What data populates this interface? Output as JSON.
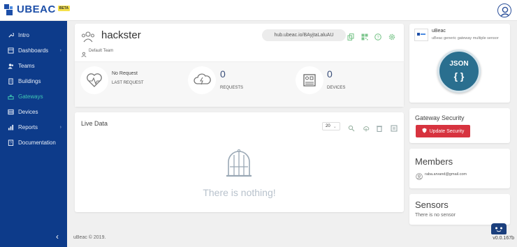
{
  "brand": {
    "name": "UBEAC",
    "badge": "BETA"
  },
  "sidebar": {
    "items": [
      {
        "label": "Intro",
        "icon": "wrench-icon",
        "chevron": ""
      },
      {
        "label": "Dashboards",
        "icon": "dashboard-icon",
        "chevron": "›"
      },
      {
        "label": "Teams",
        "icon": "teams-icon",
        "chevron": ""
      },
      {
        "label": "Buildings",
        "icon": "building-icon",
        "chevron": ""
      },
      {
        "label": "Gateways",
        "icon": "gateway-icon",
        "chevron": ""
      },
      {
        "label": "Devices",
        "icon": "devices-icon",
        "chevron": ""
      },
      {
        "label": "Reports",
        "icon": "reports-icon",
        "chevron": "›"
      },
      {
        "label": "Documentation",
        "icon": "documentation-icon",
        "chevron": ""
      }
    ],
    "active": "Gateways",
    "collapse_label": "‹"
  },
  "gateway": {
    "name": "hackster",
    "team": "Default Team",
    "url": "hub.ubeac.io/BAyjtaLaluAU",
    "stats": {
      "last_request_value": "No Request",
      "last_request_label": "LAST REQUEST",
      "requests_value": "0",
      "requests_label": "REQUESTS",
      "devices_value": "0",
      "devices_label": "DEVICES"
    }
  },
  "live_data": {
    "title": "Live Data",
    "page_size": "20",
    "page_size_chevron": "⌄",
    "empty_text": "There is nothing!"
  },
  "gateway_info": {
    "name": "uBeac",
    "description": "uBeac generic gateway multiple sensor",
    "badge_text": "JSON",
    "badge_symbol": "{ }"
  },
  "security": {
    "title": "Gateway Security",
    "button_label": "Update Security"
  },
  "members": {
    "title": "Members",
    "email": "raba.arvand@gmail.com"
  },
  "sensors": {
    "title": "Sensors",
    "empty_text": "There is no sensor"
  },
  "footer": {
    "copyright": "uBeac © 2019.",
    "version": "v0.0.167b"
  },
  "colors": {
    "sidebar_bg": "#0d3b8a",
    "active": "#3fc7b3",
    "danger": "#d7333f",
    "json_badge": "#2a6f8f",
    "tool_green": "#7dc68d"
  }
}
